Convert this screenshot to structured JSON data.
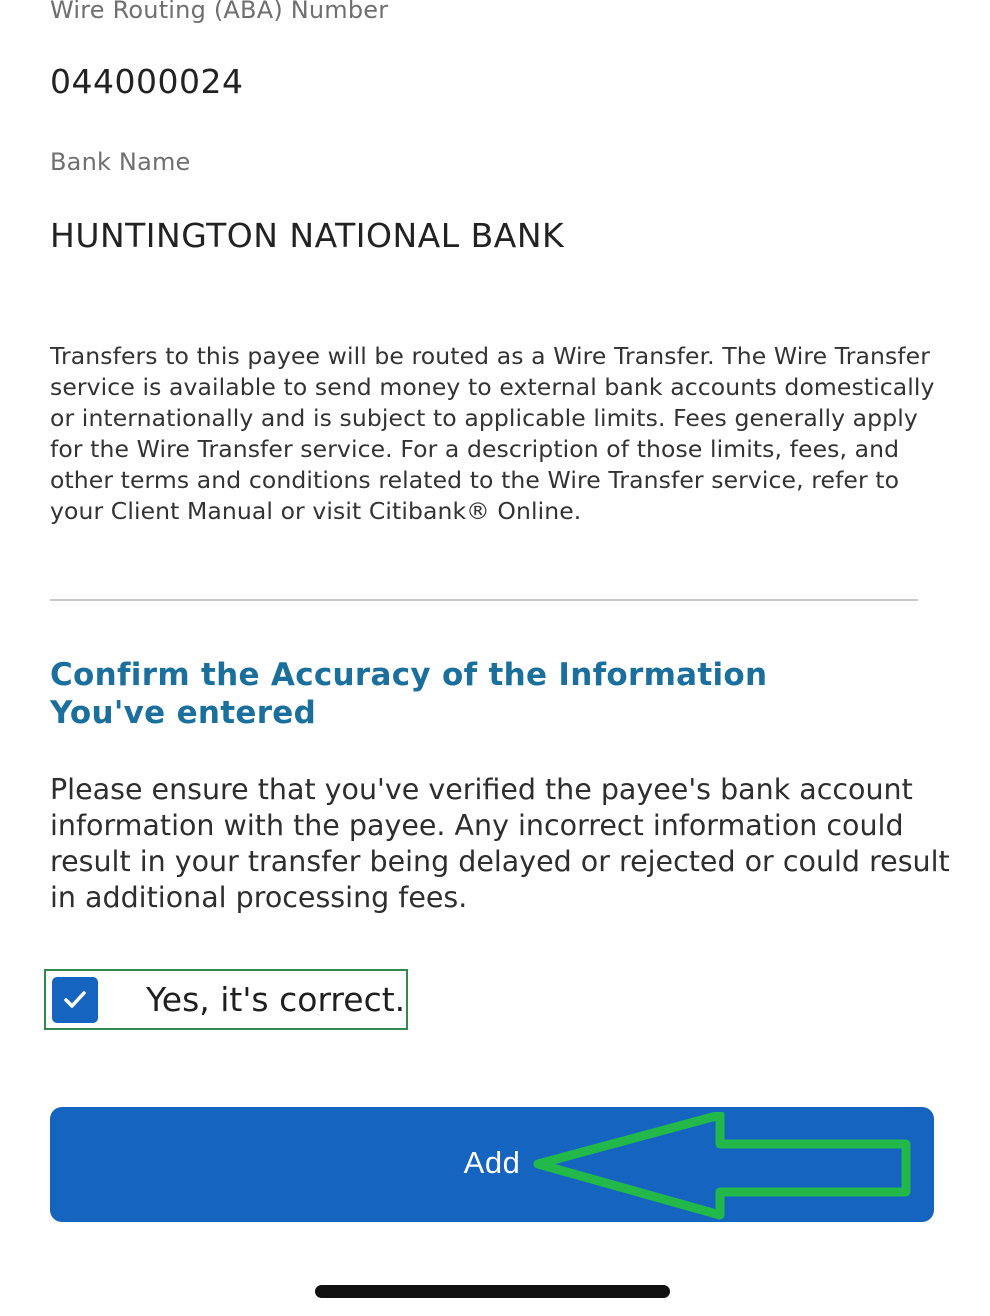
{
  "payee_details": {
    "routing_label": "Wire Routing (ABA) Number",
    "routing_value": "044000024",
    "bank_label": "Bank Name",
    "bank_value": "HUNTINGTON NATIONAL BANK"
  },
  "disclaimer": "Transfers to this payee will be routed as a Wire Transfer. The Wire Transfer service is available to send money to external bank accounts domestically or internationally and is subject to applicable limits. Fees generally apply for the Wire Transfer service. For a description of those limits, fees, and other terms and conditions related to the Wire Transfer service, refer to your Client Manual or visit Citibank® Online.",
  "confirmation": {
    "heading": "Confirm the Accuracy of the Information You've entered",
    "body": "Please ensure that you've verified the payee's bank account information with the payee. Any incorrect information could result in your transfer being delayed or rejected or could result in additional processing fees.",
    "checkbox_label": "Yes, it's correct.",
    "checkbox_checked": true
  },
  "actions": {
    "add_label": "Add"
  },
  "colors": {
    "primary": "#1565c0",
    "heading": "#1a6f9c",
    "annotation": "#22b84a"
  },
  "icons": {
    "checkbox": "check-icon",
    "annotation": "arrow-left-icon"
  }
}
